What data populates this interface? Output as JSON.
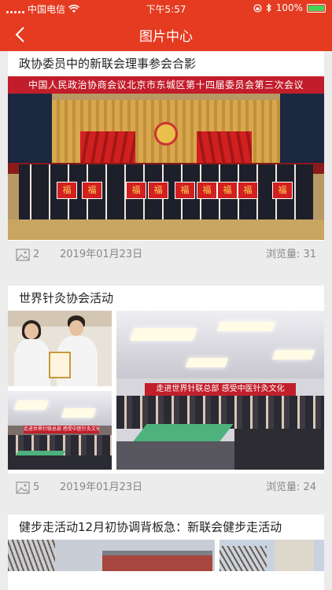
{
  "status_bar": {
    "carrier": "中国电信",
    "time": "下午5:57",
    "battery_percent": "100%",
    "battery_level": 1.0,
    "accent": "#e53b21"
  },
  "nav": {
    "title": "图片中心",
    "back_icon": "chevron-left-icon"
  },
  "posts": [
    {
      "title": "政协委员中的新联会理事参会合影",
      "photo_banner": "中国人民政治协商会议北京市东城区第十四届委员会第三次会议",
      "photo_fu": "福",
      "image_count": "2",
      "date": "2019年01月23日",
      "views": "浏览量: 31"
    },
    {
      "title": "世界针灸协会活动",
      "photo_banner": "走进世界针联总部 感受中医针灸文化",
      "image_count": "5",
      "date": "2019年01月23日",
      "views": "浏览量: 24"
    },
    {
      "title": "健步走活动12月初协调背板急：新联会健步走活动"
    }
  ]
}
